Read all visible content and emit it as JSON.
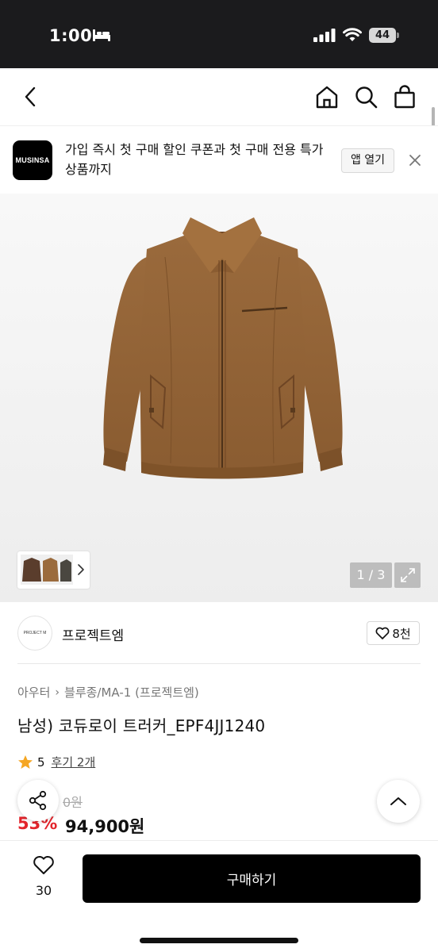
{
  "status_bar": {
    "time": "1:00",
    "battery": "44",
    "icons": [
      "bed-icon",
      "signal-icon",
      "wifi-icon",
      "battery-icon"
    ]
  },
  "nav": {
    "icons": [
      "back-arrow-icon",
      "home-icon",
      "search-icon",
      "shopping-bag-icon"
    ]
  },
  "app_banner": {
    "logo_text": "MUSINSA",
    "text": "가입 즉시 첫 구매 할인 쿠폰과 첫 구매 전용 특가 상품까지",
    "open_app_label": "앱 열기",
    "close_icon": "close-icon"
  },
  "gallery": {
    "page_counter": "1 / 3",
    "current_page": 1,
    "total_pages": 3,
    "icons": [
      "chevron-right-icon",
      "expand-icon"
    ]
  },
  "brand": {
    "logo_text": "PROJECT M",
    "name": "프로젝트엠",
    "like_count": "8천",
    "icon": "heart-outline-icon"
  },
  "breadcrumb": {
    "items": [
      "아우터",
      "블루종/MA-1 (프로젝트엠)"
    ],
    "separator": "›"
  },
  "product": {
    "title": "남성) 코듀로이 트러커_EPF4JJ1240",
    "rating": "5",
    "review_label": "후기 2개",
    "original_price": "0원",
    "discount": "53%",
    "sale_price": "94,900원",
    "accent_color": "#e3242b"
  },
  "floating": {
    "share_icon": "share-icon",
    "scroll_top_icon": "chevron-up-icon"
  },
  "bottom_bar": {
    "like_count": "30",
    "buy_label": "구매하기"
  }
}
